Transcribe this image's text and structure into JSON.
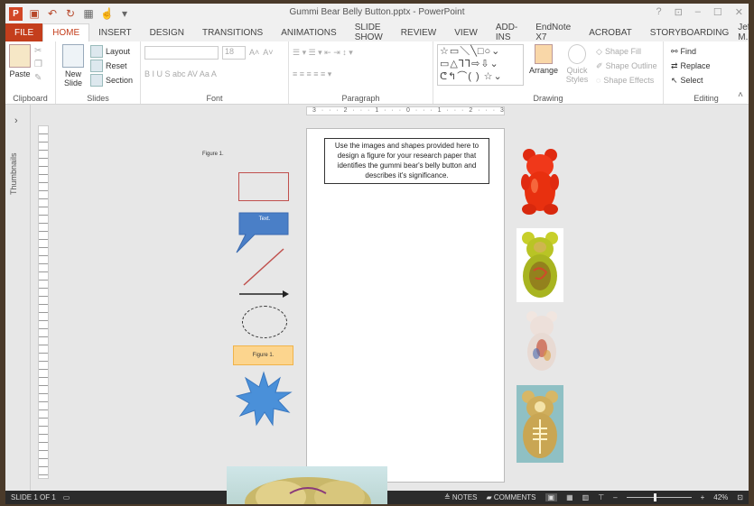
{
  "window": {
    "title": "Gummi Bear Belly Button.pptx - PowerPoint",
    "controls": [
      "?",
      "⊡",
      "–",
      "☐",
      "✕"
    ]
  },
  "quick_access": {
    "logo": "P",
    "icons": [
      "save-icon",
      "undo-icon",
      "redo-icon",
      "present-icon",
      "touch-icon"
    ]
  },
  "tabs": [
    "HOME",
    "INSERT",
    "DESIGN",
    "TRANSITIONS",
    "ANIMATIONS",
    "SLIDE SHOW",
    "REVIEW",
    "VIEW",
    "ADD-INS",
    "EndNote X7",
    "ACROBAT",
    "STORYBOARDING"
  ],
  "file_tab": "FILE",
  "account": {
    "name": "Jeffrey M...",
    "arrow": "▾"
  },
  "ribbon": {
    "clipboard": {
      "paste": "Paste",
      "label": "Clipboard"
    },
    "slides": {
      "new_slide": "New Slide",
      "layout": "Layout",
      "reset": "Reset",
      "section": "Section",
      "label": "Slides"
    },
    "font": {
      "size": "18",
      "row2": "B  I  U  S  abc  AV  Aa  A",
      "label": "Font"
    },
    "paragraph": {
      "label": "Paragraph"
    },
    "drawing": {
      "arrange": "Arrange",
      "quick_styles": "Quick Styles",
      "shape_fill": "Shape Fill",
      "shape_outline": "Shape Outline",
      "shape_effects": "Shape Effects",
      "label": "Drawing"
    },
    "editing": {
      "find": "Find",
      "replace": "Replace",
      "select": "Select",
      "label": "Editing"
    }
  },
  "thumbnails_label": "Thumbnails",
  "ruler_text": "3 · · · 2 · · · 1 · · · 0 · · · 1 · · · 2 · · · 3",
  "slide": {
    "instructions": "Use the images and shapes provided here to design a figure for your research paper that identifies the gummi bear's belly button and describes it's significance."
  },
  "canvas": {
    "figure_label": "Figure 1.",
    "callout_text": "Text.",
    "figure_box_text": "Figure 1."
  },
  "status": {
    "slide_info": "SLIDE 1 OF 1",
    "notes": "NOTES",
    "comments": "COMMENTS",
    "zoom": "42%"
  },
  "colors": {
    "accent": "#c43e1c",
    "callout": "#4a7fc7",
    "rect_outline": "#c0504d",
    "figure_fill": "#fcd58e",
    "star": "#4a90d9"
  }
}
